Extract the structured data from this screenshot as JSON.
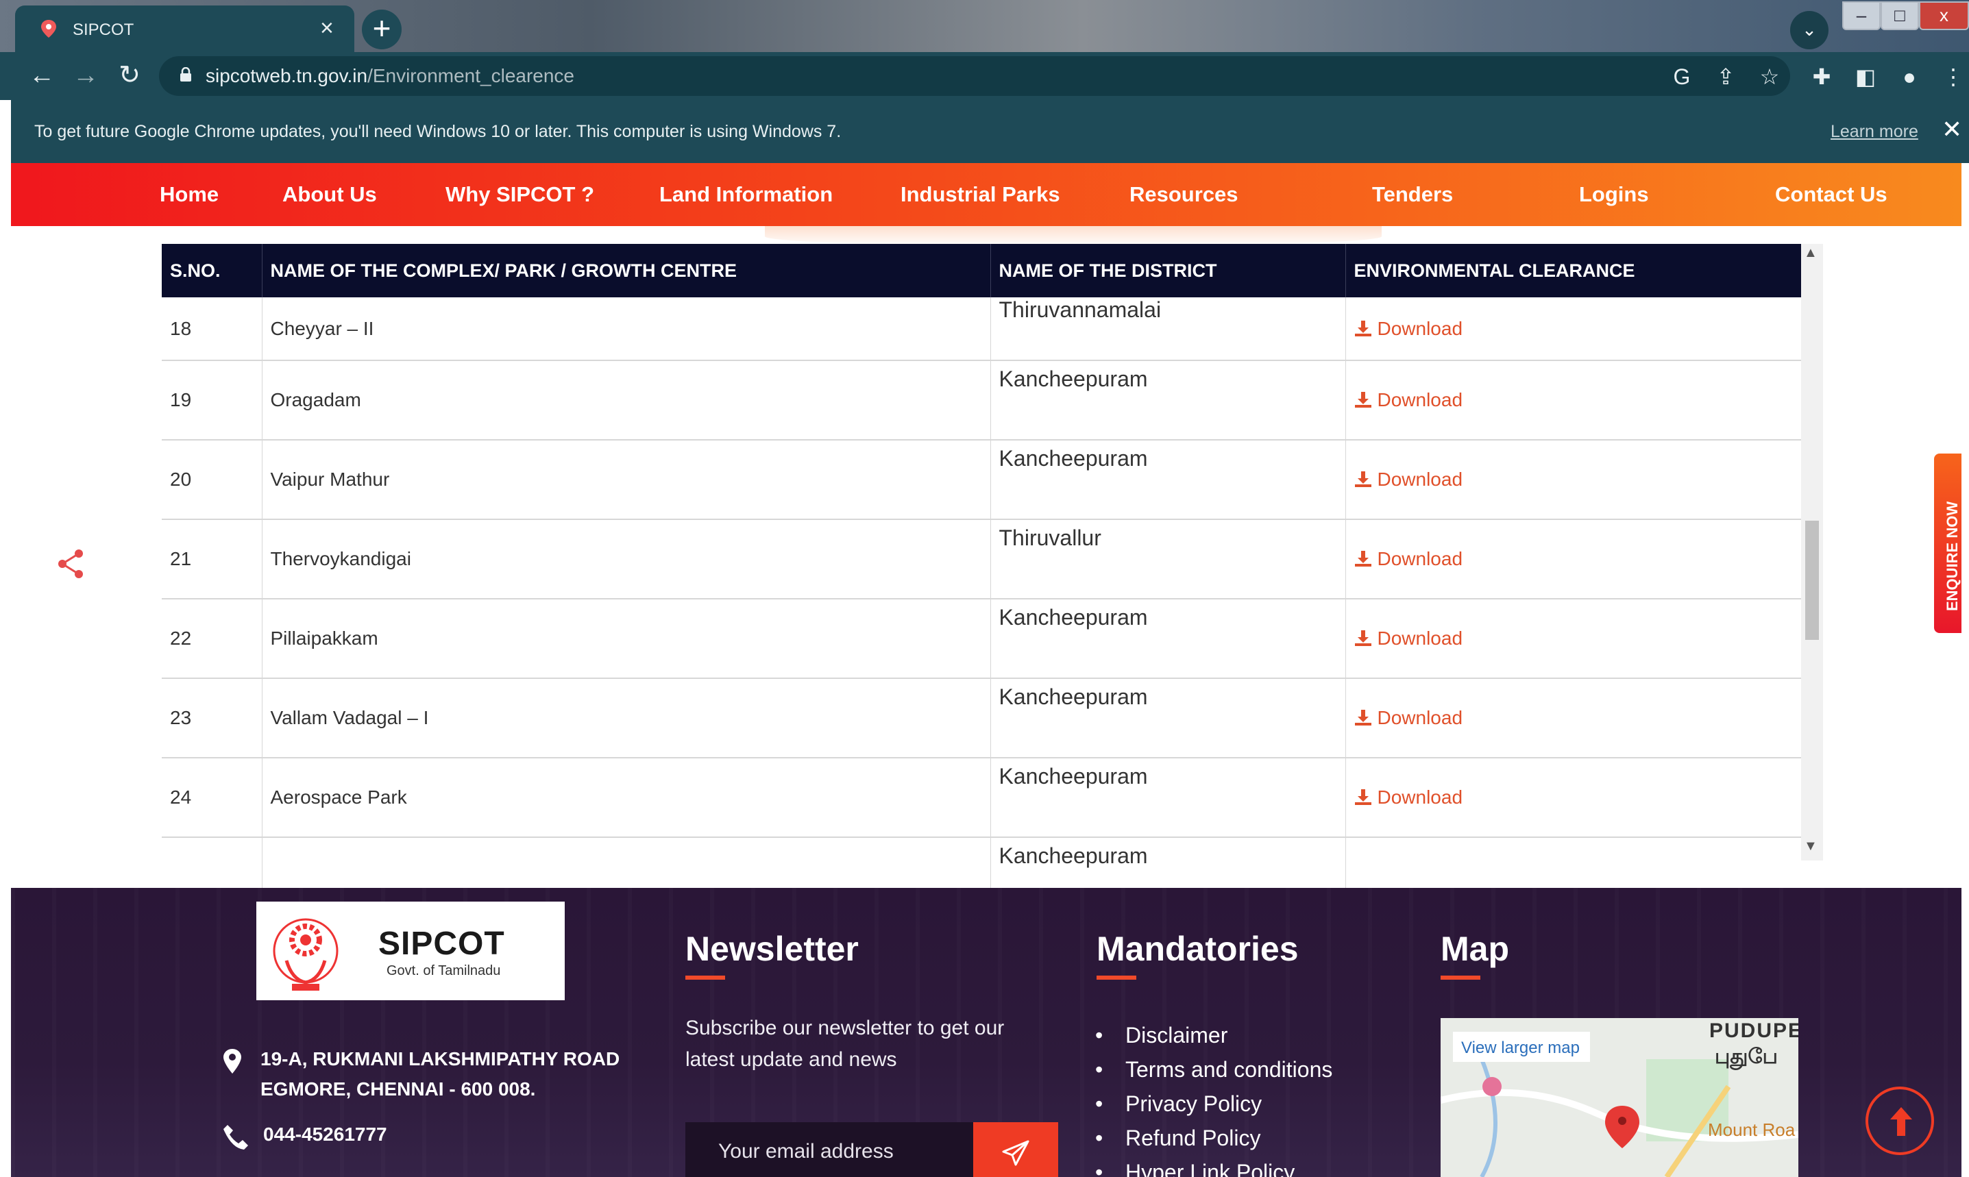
{
  "browser": {
    "tab_title": "SIPCOT",
    "url_host": "sipcotweb.tn.gov.in",
    "url_path": "/Environment_clearence",
    "infobar_message": "To get future Google Chrome updates, you'll need Windows 10 or later. This computer is using Windows 7.",
    "infobar_link": "Learn more"
  },
  "nav": {
    "items": [
      "Home",
      "About Us",
      "Why SIPCOT ?",
      "Land Information",
      "Industrial Parks",
      "Resources",
      "Tenders",
      "Logins",
      "Contact Us"
    ]
  },
  "table": {
    "headers": [
      "S.NO.",
      "NAME OF THE COMPLEX/ PARK / GROWTH CENTRE",
      "NAME OF THE DISTRICT",
      "ENVIRONMENTAL CLEARANCE"
    ],
    "rows": [
      {
        "sno": "18",
        "name": "Cheyyar – II",
        "district": "Thiruvannamalai",
        "link": "Download"
      },
      {
        "sno": "19",
        "name": "Oragadam",
        "district": "Kancheepuram",
        "link": "Download"
      },
      {
        "sno": "20",
        "name": "Vaipur Mathur",
        "district": "Kancheepuram",
        "link": "Download"
      },
      {
        "sno": "21",
        "name": "Thervoykandigai",
        "district": "Thiruvallur",
        "link": "Download"
      },
      {
        "sno": "22",
        "name": "Pillaipakkam",
        "district": "Kancheepuram",
        "link": "Download"
      },
      {
        "sno": "23",
        "name": "Vallam Vadagal – I",
        "district": "Kancheepuram",
        "link": "Download"
      },
      {
        "sno": "24",
        "name": "Aerospace Park",
        "district": "Kancheepuram",
        "link": "Download"
      },
      {
        "sno": "",
        "name": "",
        "district": "Kancheepuram",
        "link": ""
      }
    ]
  },
  "enquire_label": "ENQUIRE NOW",
  "footer": {
    "logo_name": "SIPCOT",
    "logo_sub": "Govt. of Tamilnadu",
    "address_line1": "19-A, RUKMANI LAKSHMIPATHY ROAD",
    "address_line2": "EGMORE, CHENNAI - 600 008.",
    "phone": "044-45261777",
    "newsletter_title": "Newsletter",
    "newsletter_text": "Subscribe our newsletter to get our latest update and news",
    "email_placeholder": "Your email address",
    "mandatories_title": "Mandatories",
    "mandatories": [
      "Disclaimer",
      "Terms and conditions",
      "Privacy Policy",
      "Refund Policy",
      "Hyper Link Policy"
    ],
    "map_title": "Map",
    "map_link": "View larger map",
    "map_labels": [
      "PUDUPE",
      "புதுபே",
      "Mount Roa"
    ]
  },
  "colors": {
    "brand_red": "#f0171d",
    "brand_orange": "#f88a1e",
    "table_header": "#0a0d2c",
    "download_link": "#e0502a",
    "footer_bg": "#2a1637",
    "chrome_teal": "#1e4a57"
  }
}
